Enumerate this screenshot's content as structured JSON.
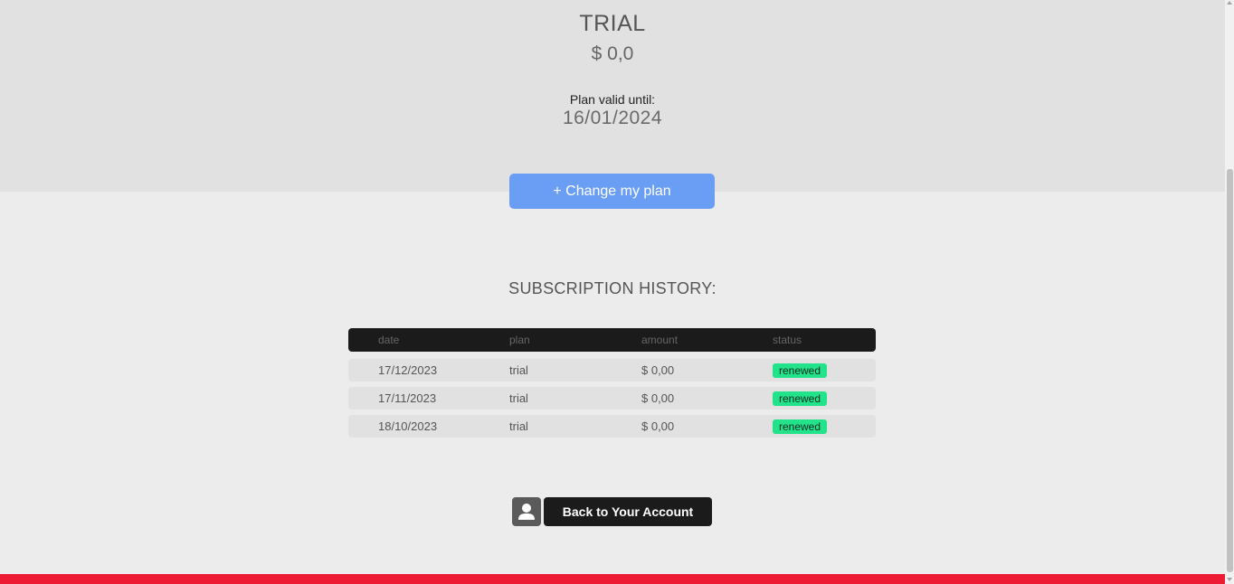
{
  "plan": {
    "name": "TRIAL",
    "price": "$ 0,0",
    "valid_label": "Plan valid until:",
    "valid_until": "16/01/2024"
  },
  "change_button": {
    "label": "+ Change my plan"
  },
  "history": {
    "title": "SUBSCRIPTION HISTORY:",
    "columns": [
      "date",
      "plan",
      "amount",
      "status"
    ],
    "rows": [
      {
        "date": "17/12/2023",
        "plan": "trial",
        "amount": "$ 0,00",
        "status": "renewed"
      },
      {
        "date": "17/11/2023",
        "plan": "trial",
        "amount": "$ 0,00",
        "status": "renewed"
      },
      {
        "date": "18/10/2023",
        "plan": "trial",
        "amount": "$ 0,00",
        "status": "renewed"
      }
    ]
  },
  "account_button": {
    "label": "Back to Your Account",
    "icon": "user-icon"
  },
  "colors": {
    "accent_blue": "#6a9ef5",
    "status_green": "#22e38a",
    "footer_red": "#ee1b35",
    "dark": "#1b1b1b"
  }
}
